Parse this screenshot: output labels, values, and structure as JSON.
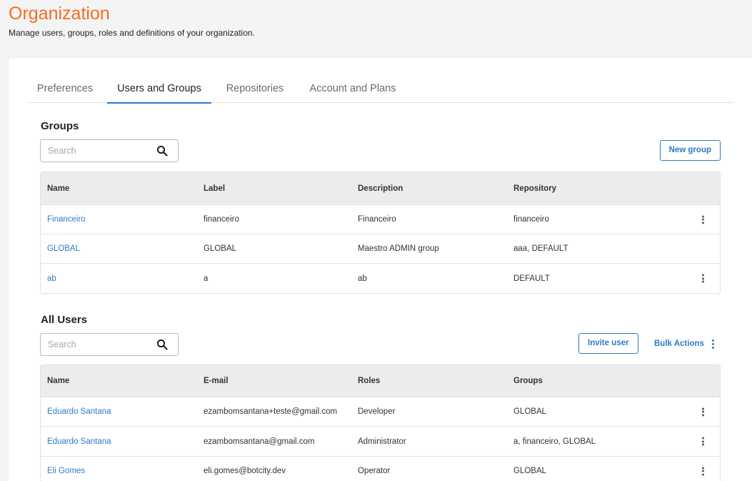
{
  "header": {
    "title": "Organization",
    "subtitle": "Manage users, groups, roles and definitions of your organization."
  },
  "tabs": [
    {
      "label": "Preferences"
    },
    {
      "label": "Users and Groups"
    },
    {
      "label": "Repositories"
    },
    {
      "label": "Account and Plans"
    }
  ],
  "groups": {
    "title": "Groups",
    "search_placeholder": "Search",
    "new_button": "New group",
    "columns": [
      "Name",
      "Label",
      "Description",
      "Repository"
    ],
    "rows": [
      {
        "name": "Financeiro",
        "label": "financeiro",
        "description": "Financeiro",
        "repository": "financeiro",
        "menu": true
      },
      {
        "name": "GLOBAL",
        "label": "GLOBAL",
        "description": "Maestro ADMIN group",
        "repository": "aaa, DEFAULT",
        "menu": false
      },
      {
        "name": "ab",
        "label": "a",
        "description": "ab",
        "repository": "DEFAULT",
        "menu": true
      }
    ]
  },
  "users": {
    "title": "All Users",
    "search_placeholder": "Search",
    "invite_button": "Invite user",
    "bulk_actions": "Bulk Actions",
    "columns": [
      "Name",
      "E-mail",
      "Roles",
      "Groups"
    ],
    "rows": [
      {
        "name": "Eduardo Santana",
        "email": "ezambomsantana+teste@gmail.com",
        "role": "Developer",
        "groups": "GLOBAL"
      },
      {
        "name": "Eduardo Santana",
        "email": "ezambomsantana@gmail.com",
        "role": "Administrator",
        "groups": "a, financeiro, GLOBAL"
      },
      {
        "name": "Eli Gomes",
        "email": "eli.gomes@botcity.dev",
        "role": "Operator",
        "groups": "GLOBAL"
      }
    ]
  },
  "colors": {
    "accent": "#f36d21",
    "link": "#2f79c8",
    "header_bg": "#ececec",
    "page_bg": "#f4f4f5"
  }
}
